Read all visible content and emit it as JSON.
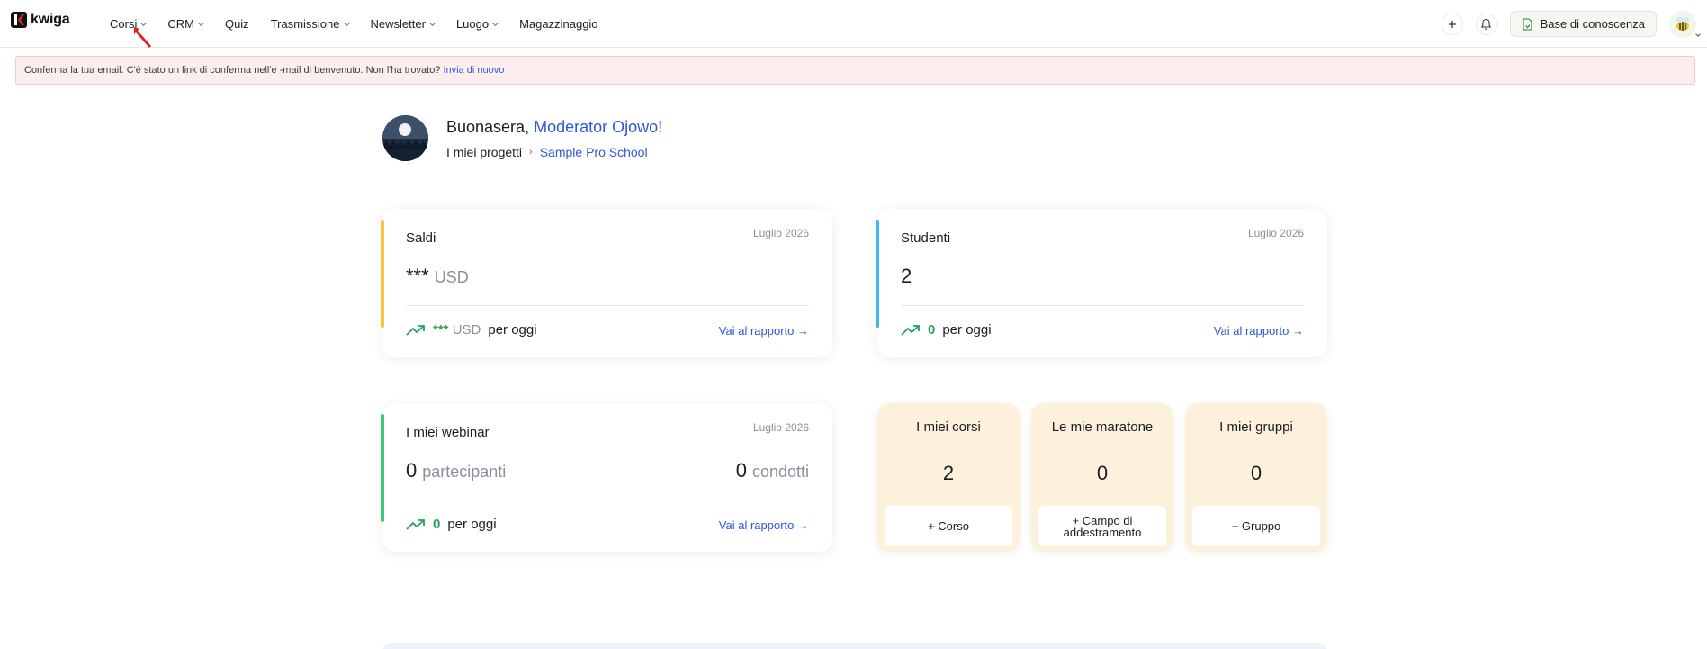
{
  "brand": {
    "name": "kwiga"
  },
  "nav": [
    {
      "label": "Corsi",
      "dropdown": true
    },
    {
      "label": "CRM",
      "dropdown": true
    },
    {
      "label": "Quiz",
      "dropdown": false
    },
    {
      "label": "Trasmissione",
      "dropdown": true
    },
    {
      "label": "Newsletter",
      "dropdown": true
    },
    {
      "label": "Luogo",
      "dropdown": true
    },
    {
      "label": "Magazzinaggio",
      "dropdown": false
    }
  ],
  "top_right": {
    "knowledge_base": "Base di conoscenza"
  },
  "alert": {
    "text": "Conferma la tua email. C'è stato un link di conferma nell'e -mail di benvenuto. Non l'ha trovato?",
    "link": "Invia di nuovo"
  },
  "greeting": {
    "prefix": "Buonasera,",
    "name": "Moderator Ojowo",
    "suffix": "!",
    "crumb_root": "I miei progetti",
    "crumb_current": "Sample Pro School"
  },
  "balance_card": {
    "title": "Saldi",
    "date": "Luglio 2026",
    "value": "***",
    "unit": "USD",
    "today_value": "***",
    "today_unit": "USD",
    "today_label": "per oggi",
    "report": "Vai al rapporto →",
    "stripe_color": "#f8c43c"
  },
  "students_card": {
    "title": "Studenti",
    "date": "Luglio 2026",
    "value": "2",
    "today_value": "0",
    "today_label": "per oggi",
    "report": "Vai al rapporto →",
    "stripe_color": "#3fb8ee"
  },
  "webinar_card": {
    "title": "I miei webinar",
    "date": "Luglio 2026",
    "participants_value": "0",
    "participants_label": "partecipanti",
    "held_value": "0",
    "held_label": "condotti",
    "today_value": "0",
    "today_label": "per oggi",
    "report": "Vai al rapporto →",
    "stripe_color": "#3ec97a"
  },
  "tiles": [
    {
      "title": "I miei corsi",
      "count": "2",
      "button": "+ Corso"
    },
    {
      "title": "Le mie maratone",
      "count": "0",
      "button": "+ Campo di addestramento"
    },
    {
      "title": "I miei gruppi",
      "count": "0",
      "button": "+ Gruppo"
    }
  ]
}
